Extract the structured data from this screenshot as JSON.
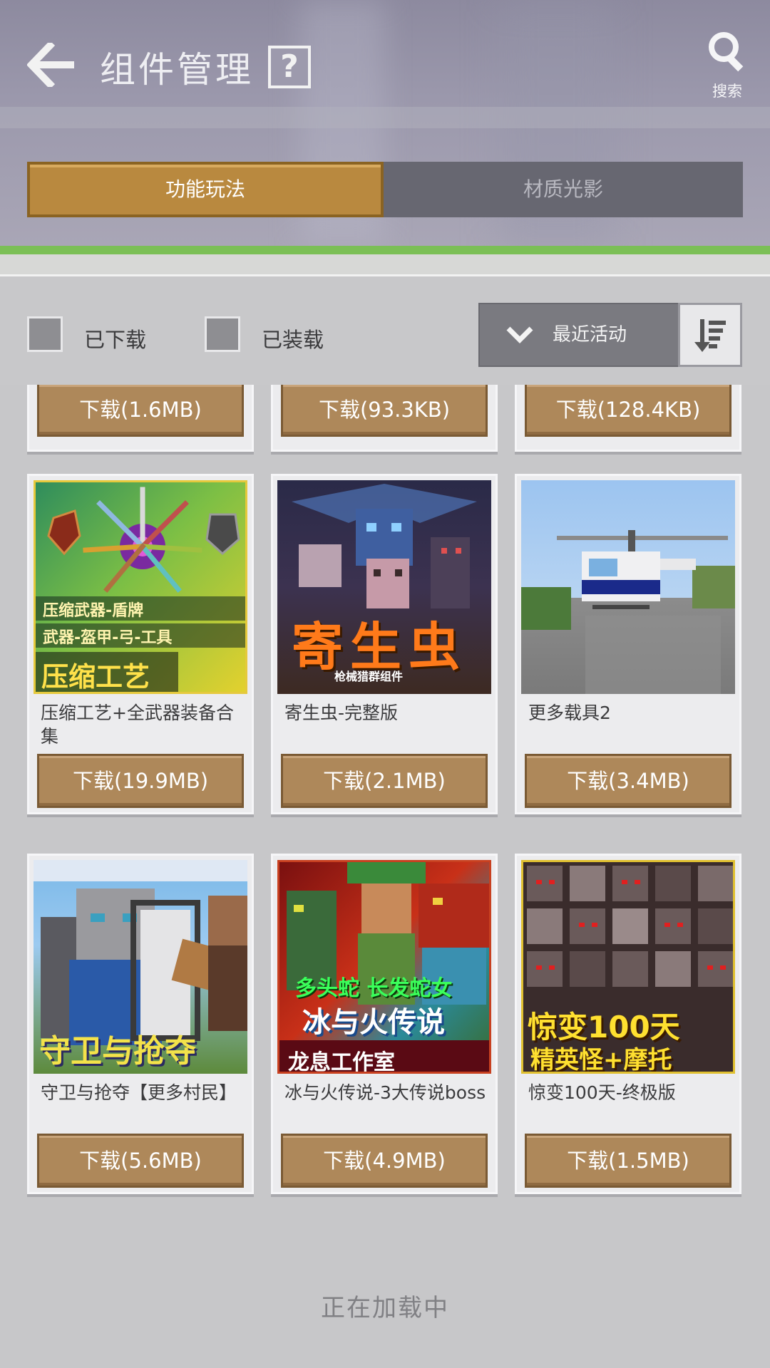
{
  "header": {
    "title": "组件管理",
    "help_label": "?",
    "search_label": "搜索"
  },
  "tabs": [
    {
      "label": "功能玩法",
      "active": true
    },
    {
      "label": "材质光影",
      "active": false
    }
  ],
  "filters": {
    "downloaded_label": "已下载",
    "installed_label": "已装载",
    "sort_value": "最近活动"
  },
  "top_row_buttons": [
    "下载(1.6MB)",
    "下载(93.3KB)",
    "下载(128.4KB)"
  ],
  "cards": [
    {
      "title": "压缩工艺+全武器装备合集",
      "button": "下载(19.9MB)",
      "thumb_lines": [
        "压缩武器-盾牌",
        "武器-盔甲-弓-工具",
        "压缩工艺"
      ]
    },
    {
      "title": "寄生虫-完整版",
      "button": "下载(2.1MB)",
      "thumb_lines": [
        "寄生虫",
        "枪械猎群组件"
      ]
    },
    {
      "title": "更多载具2",
      "button": "下载(3.4MB)",
      "thumb_lines": []
    },
    {
      "title": "守卫与抢夺【更多村民】",
      "button": "下载(5.6MB)",
      "thumb_lines": [
        "守卫与抢夺"
      ]
    },
    {
      "title": "冰与火传说-3大传说boss",
      "button": "下载(4.9MB)",
      "thumb_lines": [
        "多头蛇 长发蛇女",
        "冰与火传说",
        "龙息工作室"
      ]
    },
    {
      "title": "惊变100天-终极版",
      "button": "下载(1.5MB)",
      "thumb_lines": [
        "惊变100天",
        "精英怪+摩托"
      ]
    }
  ],
  "footer": {
    "loading_text": "正在加载中"
  },
  "colors": {
    "accent_tab": "#b9893f",
    "download_button": "#ae885a",
    "green_bar": "#7bbf56"
  }
}
